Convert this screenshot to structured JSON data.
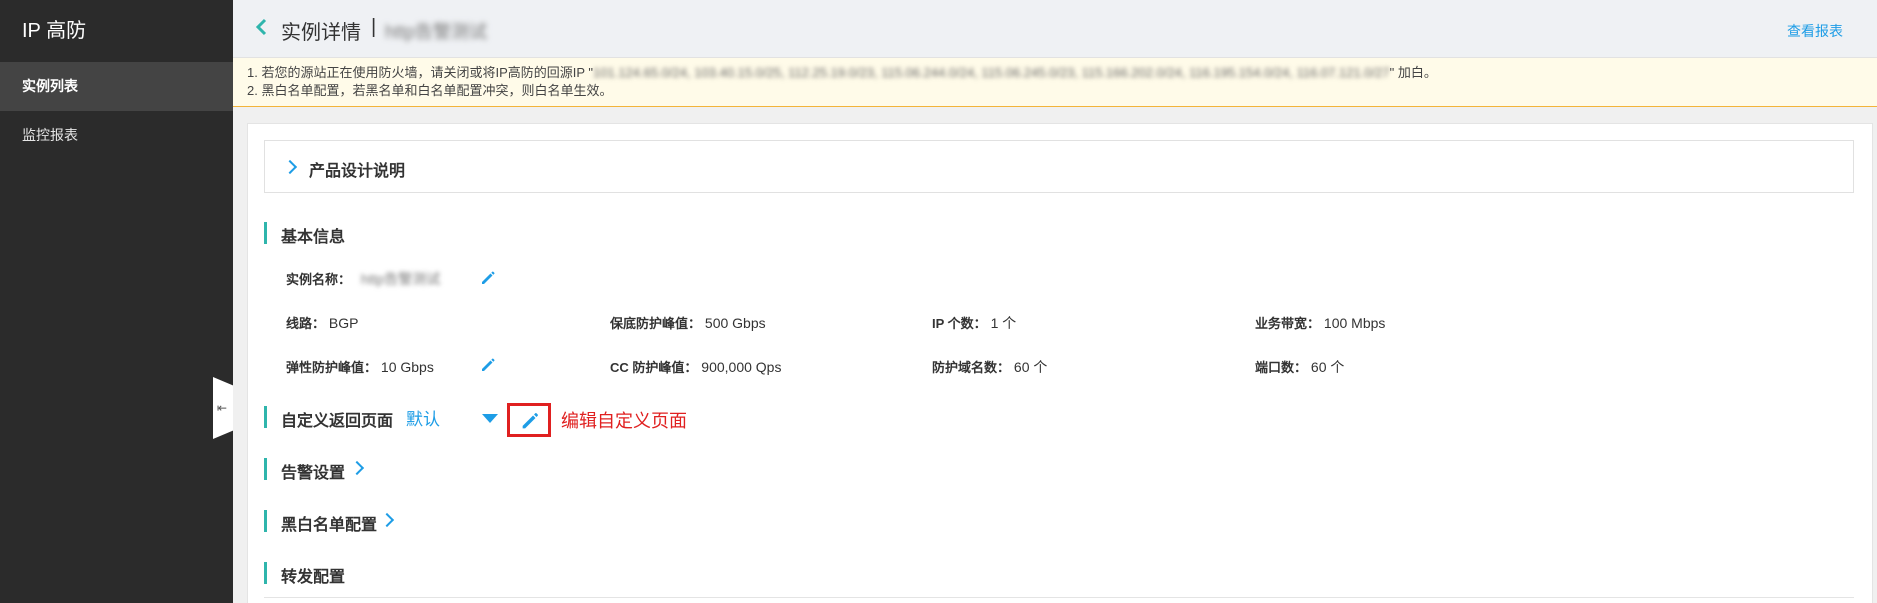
{
  "sidebar": {
    "title": "IP 高防",
    "items": [
      {
        "label": "实例列表",
        "active": true
      },
      {
        "label": "监控报表",
        "active": false
      }
    ]
  },
  "header": {
    "title": "实例详情",
    "separator": "|",
    "instance_name_blurred": "http告警测试",
    "report_link": "查看报表"
  },
  "notice": {
    "line1_prefix": "1. 若您的源站正在使用防火墙，请关闭或将IP高防的回源IP \"",
    "line1_ips_blurred": "101.124.65.0/24, 103.40.15.0/25, 112.25.19.0/23, 115.06.244.0/24, 115.06.245.0/23, 115.166.202.0/24, 116.195.154.0/24, 116.07.121.0/27",
    "line1_suffix": "\" 加白。",
    "line2": "2. 黑白名单配置，若黑名单和白名单配置冲突，则白名单生效。"
  },
  "panel": {
    "product_design": "产品设计说明"
  },
  "basic_info": {
    "title": "基本信息",
    "instance_name_label": "实例名称：",
    "instance_name_value": "http告警测试",
    "fields": [
      {
        "label": "线路：",
        "value": "BGP"
      },
      {
        "label": "保底防护峰值：",
        "value": "500 Gbps"
      },
      {
        "label": "IP 个数：",
        "value": "1 个"
      },
      {
        "label": "业务带宽：",
        "value": "100 Mbps"
      },
      {
        "label": "弹性防护峰值：",
        "value": "10 Gbps"
      },
      {
        "label": "CC 防护峰值：",
        "value": "900,000 Qps"
      },
      {
        "label": "防护域名数：",
        "value": "60 个"
      },
      {
        "label": "端口数：",
        "value": "60 个"
      }
    ]
  },
  "custom_page": {
    "title": "自定义返回页面",
    "selected": "默认",
    "edit_annotation": "编辑自定义页面"
  },
  "alert_settings": {
    "title": "告警设置"
  },
  "blacklist": {
    "title": "黑白名单配置"
  },
  "forwarding": {
    "title": "转发配置"
  },
  "colors": {
    "accent": "#1e9de6",
    "section_bar": "#2fb5ac",
    "annotation_red": "#e02020",
    "sidebar_bg": "#2b2b2b"
  }
}
